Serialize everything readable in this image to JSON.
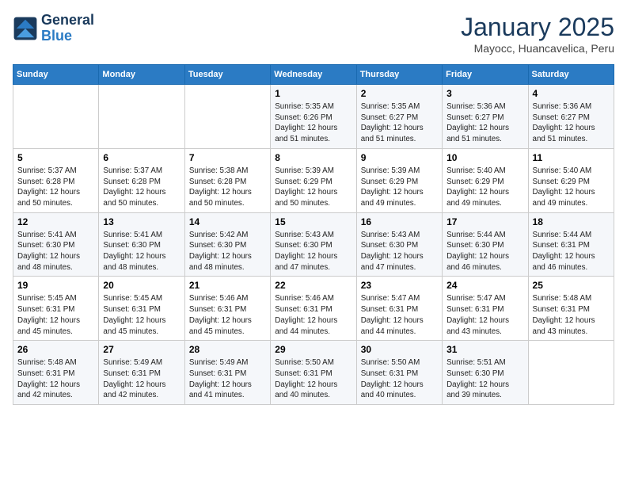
{
  "header": {
    "logo_line1": "General",
    "logo_line2": "Blue",
    "month": "January 2025",
    "location": "Mayocc, Huancavelica, Peru"
  },
  "days_of_week": [
    "Sunday",
    "Monday",
    "Tuesday",
    "Wednesday",
    "Thursday",
    "Friday",
    "Saturday"
  ],
  "weeks": [
    [
      {
        "day": "",
        "info": ""
      },
      {
        "day": "",
        "info": ""
      },
      {
        "day": "",
        "info": ""
      },
      {
        "day": "1",
        "info": "Sunrise: 5:35 AM\nSunset: 6:26 PM\nDaylight: 12 hours\nand 51 minutes."
      },
      {
        "day": "2",
        "info": "Sunrise: 5:35 AM\nSunset: 6:27 PM\nDaylight: 12 hours\nand 51 minutes."
      },
      {
        "day": "3",
        "info": "Sunrise: 5:36 AM\nSunset: 6:27 PM\nDaylight: 12 hours\nand 51 minutes."
      },
      {
        "day": "4",
        "info": "Sunrise: 5:36 AM\nSunset: 6:27 PM\nDaylight: 12 hours\nand 51 minutes."
      }
    ],
    [
      {
        "day": "5",
        "info": "Sunrise: 5:37 AM\nSunset: 6:28 PM\nDaylight: 12 hours\nand 50 minutes."
      },
      {
        "day": "6",
        "info": "Sunrise: 5:37 AM\nSunset: 6:28 PM\nDaylight: 12 hours\nand 50 minutes."
      },
      {
        "day": "7",
        "info": "Sunrise: 5:38 AM\nSunset: 6:28 PM\nDaylight: 12 hours\nand 50 minutes."
      },
      {
        "day": "8",
        "info": "Sunrise: 5:39 AM\nSunset: 6:29 PM\nDaylight: 12 hours\nand 50 minutes."
      },
      {
        "day": "9",
        "info": "Sunrise: 5:39 AM\nSunset: 6:29 PM\nDaylight: 12 hours\nand 49 minutes."
      },
      {
        "day": "10",
        "info": "Sunrise: 5:40 AM\nSunset: 6:29 PM\nDaylight: 12 hours\nand 49 minutes."
      },
      {
        "day": "11",
        "info": "Sunrise: 5:40 AM\nSunset: 6:29 PM\nDaylight: 12 hours\nand 49 minutes."
      }
    ],
    [
      {
        "day": "12",
        "info": "Sunrise: 5:41 AM\nSunset: 6:30 PM\nDaylight: 12 hours\nand 48 minutes."
      },
      {
        "day": "13",
        "info": "Sunrise: 5:41 AM\nSunset: 6:30 PM\nDaylight: 12 hours\nand 48 minutes."
      },
      {
        "day": "14",
        "info": "Sunrise: 5:42 AM\nSunset: 6:30 PM\nDaylight: 12 hours\nand 48 minutes."
      },
      {
        "day": "15",
        "info": "Sunrise: 5:43 AM\nSunset: 6:30 PM\nDaylight: 12 hours\nand 47 minutes."
      },
      {
        "day": "16",
        "info": "Sunrise: 5:43 AM\nSunset: 6:30 PM\nDaylight: 12 hours\nand 47 minutes."
      },
      {
        "day": "17",
        "info": "Sunrise: 5:44 AM\nSunset: 6:30 PM\nDaylight: 12 hours\nand 46 minutes."
      },
      {
        "day": "18",
        "info": "Sunrise: 5:44 AM\nSunset: 6:31 PM\nDaylight: 12 hours\nand 46 minutes."
      }
    ],
    [
      {
        "day": "19",
        "info": "Sunrise: 5:45 AM\nSunset: 6:31 PM\nDaylight: 12 hours\nand 45 minutes."
      },
      {
        "day": "20",
        "info": "Sunrise: 5:45 AM\nSunset: 6:31 PM\nDaylight: 12 hours\nand 45 minutes."
      },
      {
        "day": "21",
        "info": "Sunrise: 5:46 AM\nSunset: 6:31 PM\nDaylight: 12 hours\nand 45 minutes."
      },
      {
        "day": "22",
        "info": "Sunrise: 5:46 AM\nSunset: 6:31 PM\nDaylight: 12 hours\nand 44 minutes."
      },
      {
        "day": "23",
        "info": "Sunrise: 5:47 AM\nSunset: 6:31 PM\nDaylight: 12 hours\nand 44 minutes."
      },
      {
        "day": "24",
        "info": "Sunrise: 5:47 AM\nSunset: 6:31 PM\nDaylight: 12 hours\nand 43 minutes."
      },
      {
        "day": "25",
        "info": "Sunrise: 5:48 AM\nSunset: 6:31 PM\nDaylight: 12 hours\nand 43 minutes."
      }
    ],
    [
      {
        "day": "26",
        "info": "Sunrise: 5:48 AM\nSunset: 6:31 PM\nDaylight: 12 hours\nand 42 minutes."
      },
      {
        "day": "27",
        "info": "Sunrise: 5:49 AM\nSunset: 6:31 PM\nDaylight: 12 hours\nand 42 minutes."
      },
      {
        "day": "28",
        "info": "Sunrise: 5:49 AM\nSunset: 6:31 PM\nDaylight: 12 hours\nand 41 minutes."
      },
      {
        "day": "29",
        "info": "Sunrise: 5:50 AM\nSunset: 6:31 PM\nDaylight: 12 hours\nand 40 minutes."
      },
      {
        "day": "30",
        "info": "Sunrise: 5:50 AM\nSunset: 6:31 PM\nDaylight: 12 hours\nand 40 minutes."
      },
      {
        "day": "31",
        "info": "Sunrise: 5:51 AM\nSunset: 6:30 PM\nDaylight: 12 hours\nand 39 minutes."
      },
      {
        "day": "",
        "info": ""
      }
    ]
  ]
}
